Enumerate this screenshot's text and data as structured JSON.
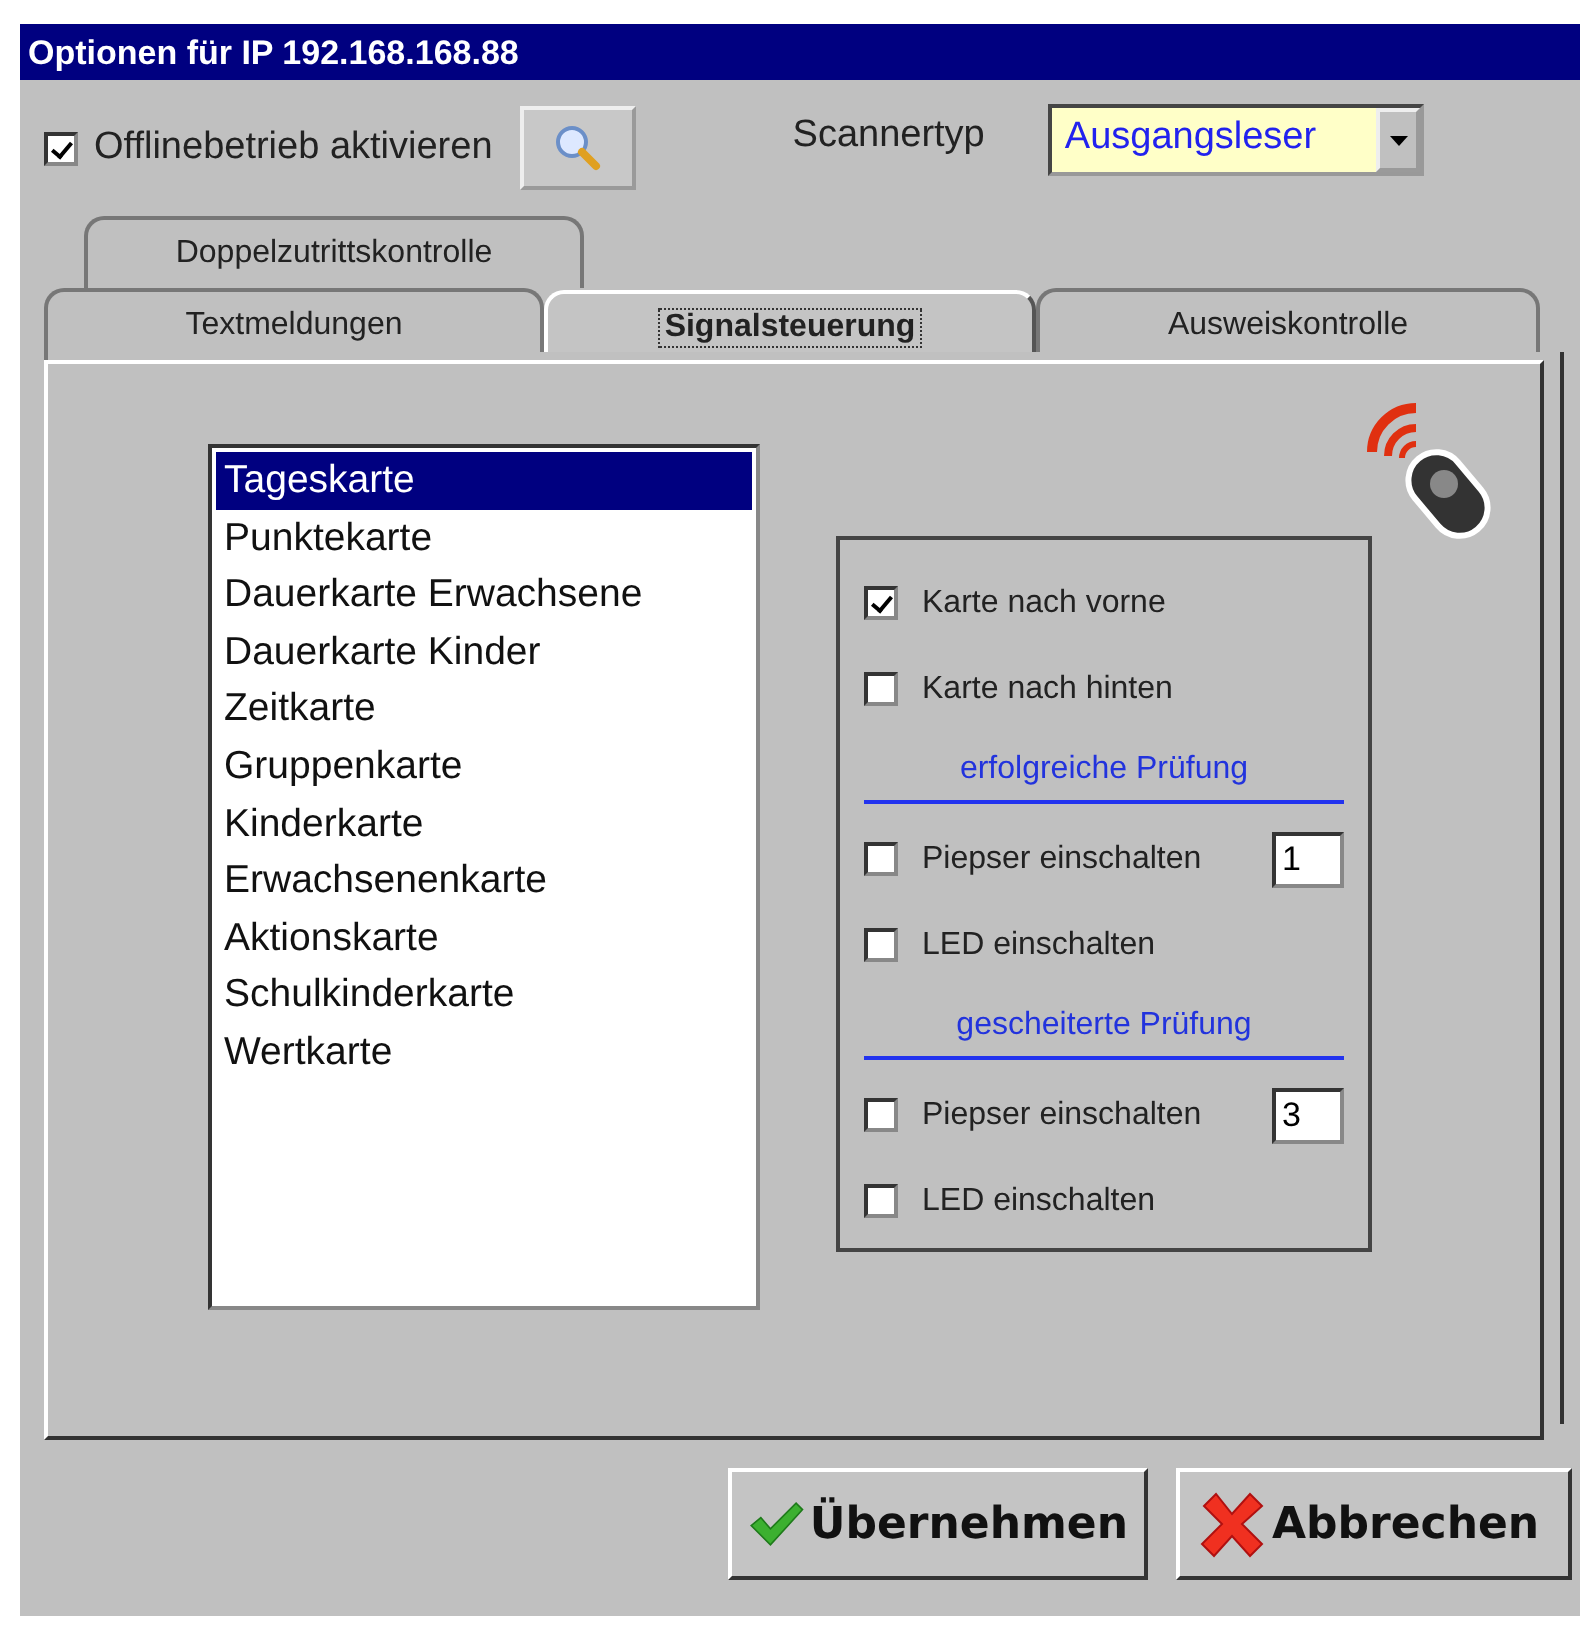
{
  "window": {
    "title": "Optionen für IP 192.168.168.88"
  },
  "offline": {
    "label": "Offlinebetrieb aktivieren",
    "checked": true
  },
  "scanner": {
    "label": "Scannertyp",
    "value": "Ausgangsleser"
  },
  "tab_rows": [
    [
      {
        "label": "Doppelzutrittskontrolle",
        "selected": false
      }
    ],
    [
      {
        "label": "Textmeldungen",
        "selected": false
      },
      {
        "label": "Signalsteuerung",
        "selected": true
      },
      {
        "label": "Ausweiskontrolle",
        "selected": false
      }
    ]
  ],
  "card_types": [
    {
      "label": "Tageskarte",
      "selected": true
    },
    {
      "label": "Punktekarte",
      "selected": false
    },
    {
      "label": "Dauerkarte Erwachsene",
      "selected": false
    },
    {
      "label": "Dauerkarte Kinder",
      "selected": false
    },
    {
      "label": "Zeitkarte",
      "selected": false
    },
    {
      "label": "Gruppenkarte",
      "selected": false
    },
    {
      "label": "Kinderkarte",
      "selected": false
    },
    {
      "label": "Erwachsenenkarte",
      "selected": false
    },
    {
      "label": "Aktionskarte",
      "selected": false
    },
    {
      "label": "Schulkinderkarte",
      "selected": false
    },
    {
      "label": "Wertkarte",
      "selected": false
    }
  ],
  "signal_options": [
    {
      "kind": "checkbox",
      "label": "Karte nach vorne",
      "checked": true
    },
    {
      "kind": "checkbox",
      "label": "Karte nach hinten",
      "checked": false
    },
    {
      "kind": "heading",
      "label": "erfolgreiche Prüfung"
    },
    {
      "kind": "checkbox",
      "label": "Piepser einschalten",
      "checked": false,
      "value": "1"
    },
    {
      "kind": "checkbox",
      "label": "LED einschalten",
      "checked": false
    },
    {
      "kind": "heading",
      "label": "gescheiterte Prüfung"
    },
    {
      "kind": "checkbox",
      "label": "Piepser einschalten",
      "checked": false,
      "value": "3"
    },
    {
      "kind": "checkbox",
      "label": "LED einschalten",
      "checked": false
    }
  ],
  "buttons": [
    {
      "kind": "ok",
      "label": "Übernehmen"
    },
    {
      "kind": "cancel",
      "label": "Abbrechen"
    }
  ]
}
